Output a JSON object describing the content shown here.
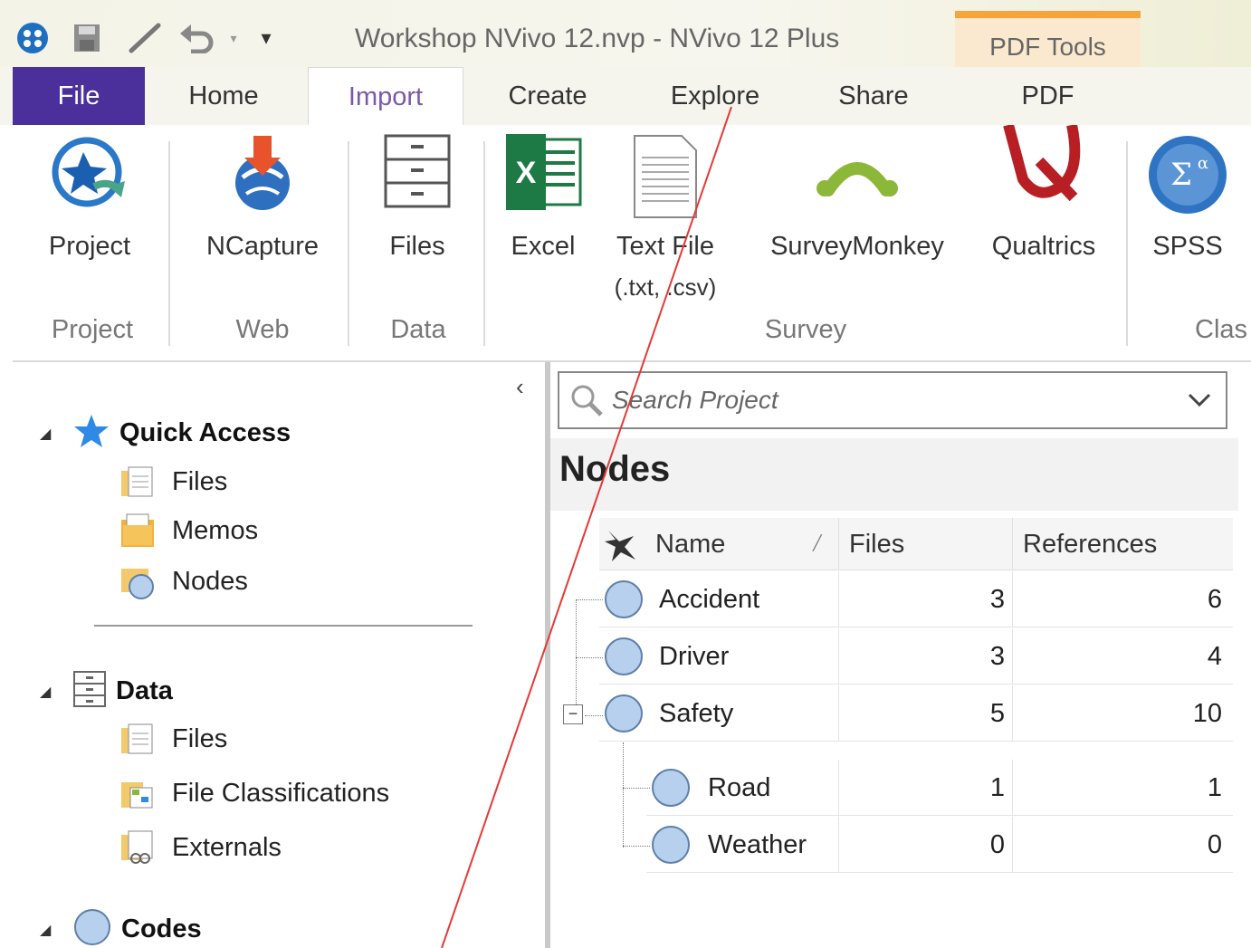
{
  "titlebar": {
    "window_title": "Workshop NVivo 12.nvp - NVivo 12 Plus",
    "context_tab_group": "PDF Tools"
  },
  "tabs": [
    {
      "label": "File"
    },
    {
      "label": "Home"
    },
    {
      "label": "Import",
      "selected": true
    },
    {
      "label": "Create"
    },
    {
      "label": "Explore"
    },
    {
      "label": "Share"
    },
    {
      "label": "PDF"
    }
  ],
  "ribbon": {
    "buttons": {
      "project": "Project",
      "ncapture": "NCapture",
      "files": "Files",
      "excel": "Excel",
      "textfile_line1": "Text File",
      "textfile_line2": "(.txt, .csv)",
      "surveymonkey": "SurveyMonkey",
      "qualtrics": "Qualtrics",
      "spss": "SPSS"
    },
    "groups": {
      "project": "Project",
      "web": "Web",
      "data": "Data",
      "survey": "Survey",
      "clas": "Clas"
    }
  },
  "nav": {
    "quick_access": {
      "heading": "Quick Access",
      "items": [
        "Files",
        "Memos",
        "Nodes"
      ]
    },
    "data": {
      "heading": "Data",
      "items": [
        "Files",
        "File Classifications",
        "Externals"
      ]
    },
    "codes": {
      "heading": "Codes"
    }
  },
  "detail": {
    "search_placeholder": "Search Project",
    "title": "Nodes",
    "columns": {
      "name": "Name",
      "files": "Files",
      "references": "References"
    },
    "rows": [
      {
        "name": "Accident",
        "files": "3",
        "references": "6"
      },
      {
        "name": "Driver",
        "files": "3",
        "references": "4"
      },
      {
        "name": "Safety",
        "files": "5",
        "references": "10"
      }
    ],
    "child_rows": [
      {
        "name": "Road",
        "files": "1",
        "references": "1"
      },
      {
        "name": "Weather",
        "files": "0",
        "references": "0"
      }
    ]
  },
  "colors": {
    "file_tab": "#4b2f9a",
    "context_tab": "#fbe9cf",
    "context_accent": "#f5a53b",
    "node_fill": "#b7d0ee",
    "annotation_line": "#e53935"
  }
}
